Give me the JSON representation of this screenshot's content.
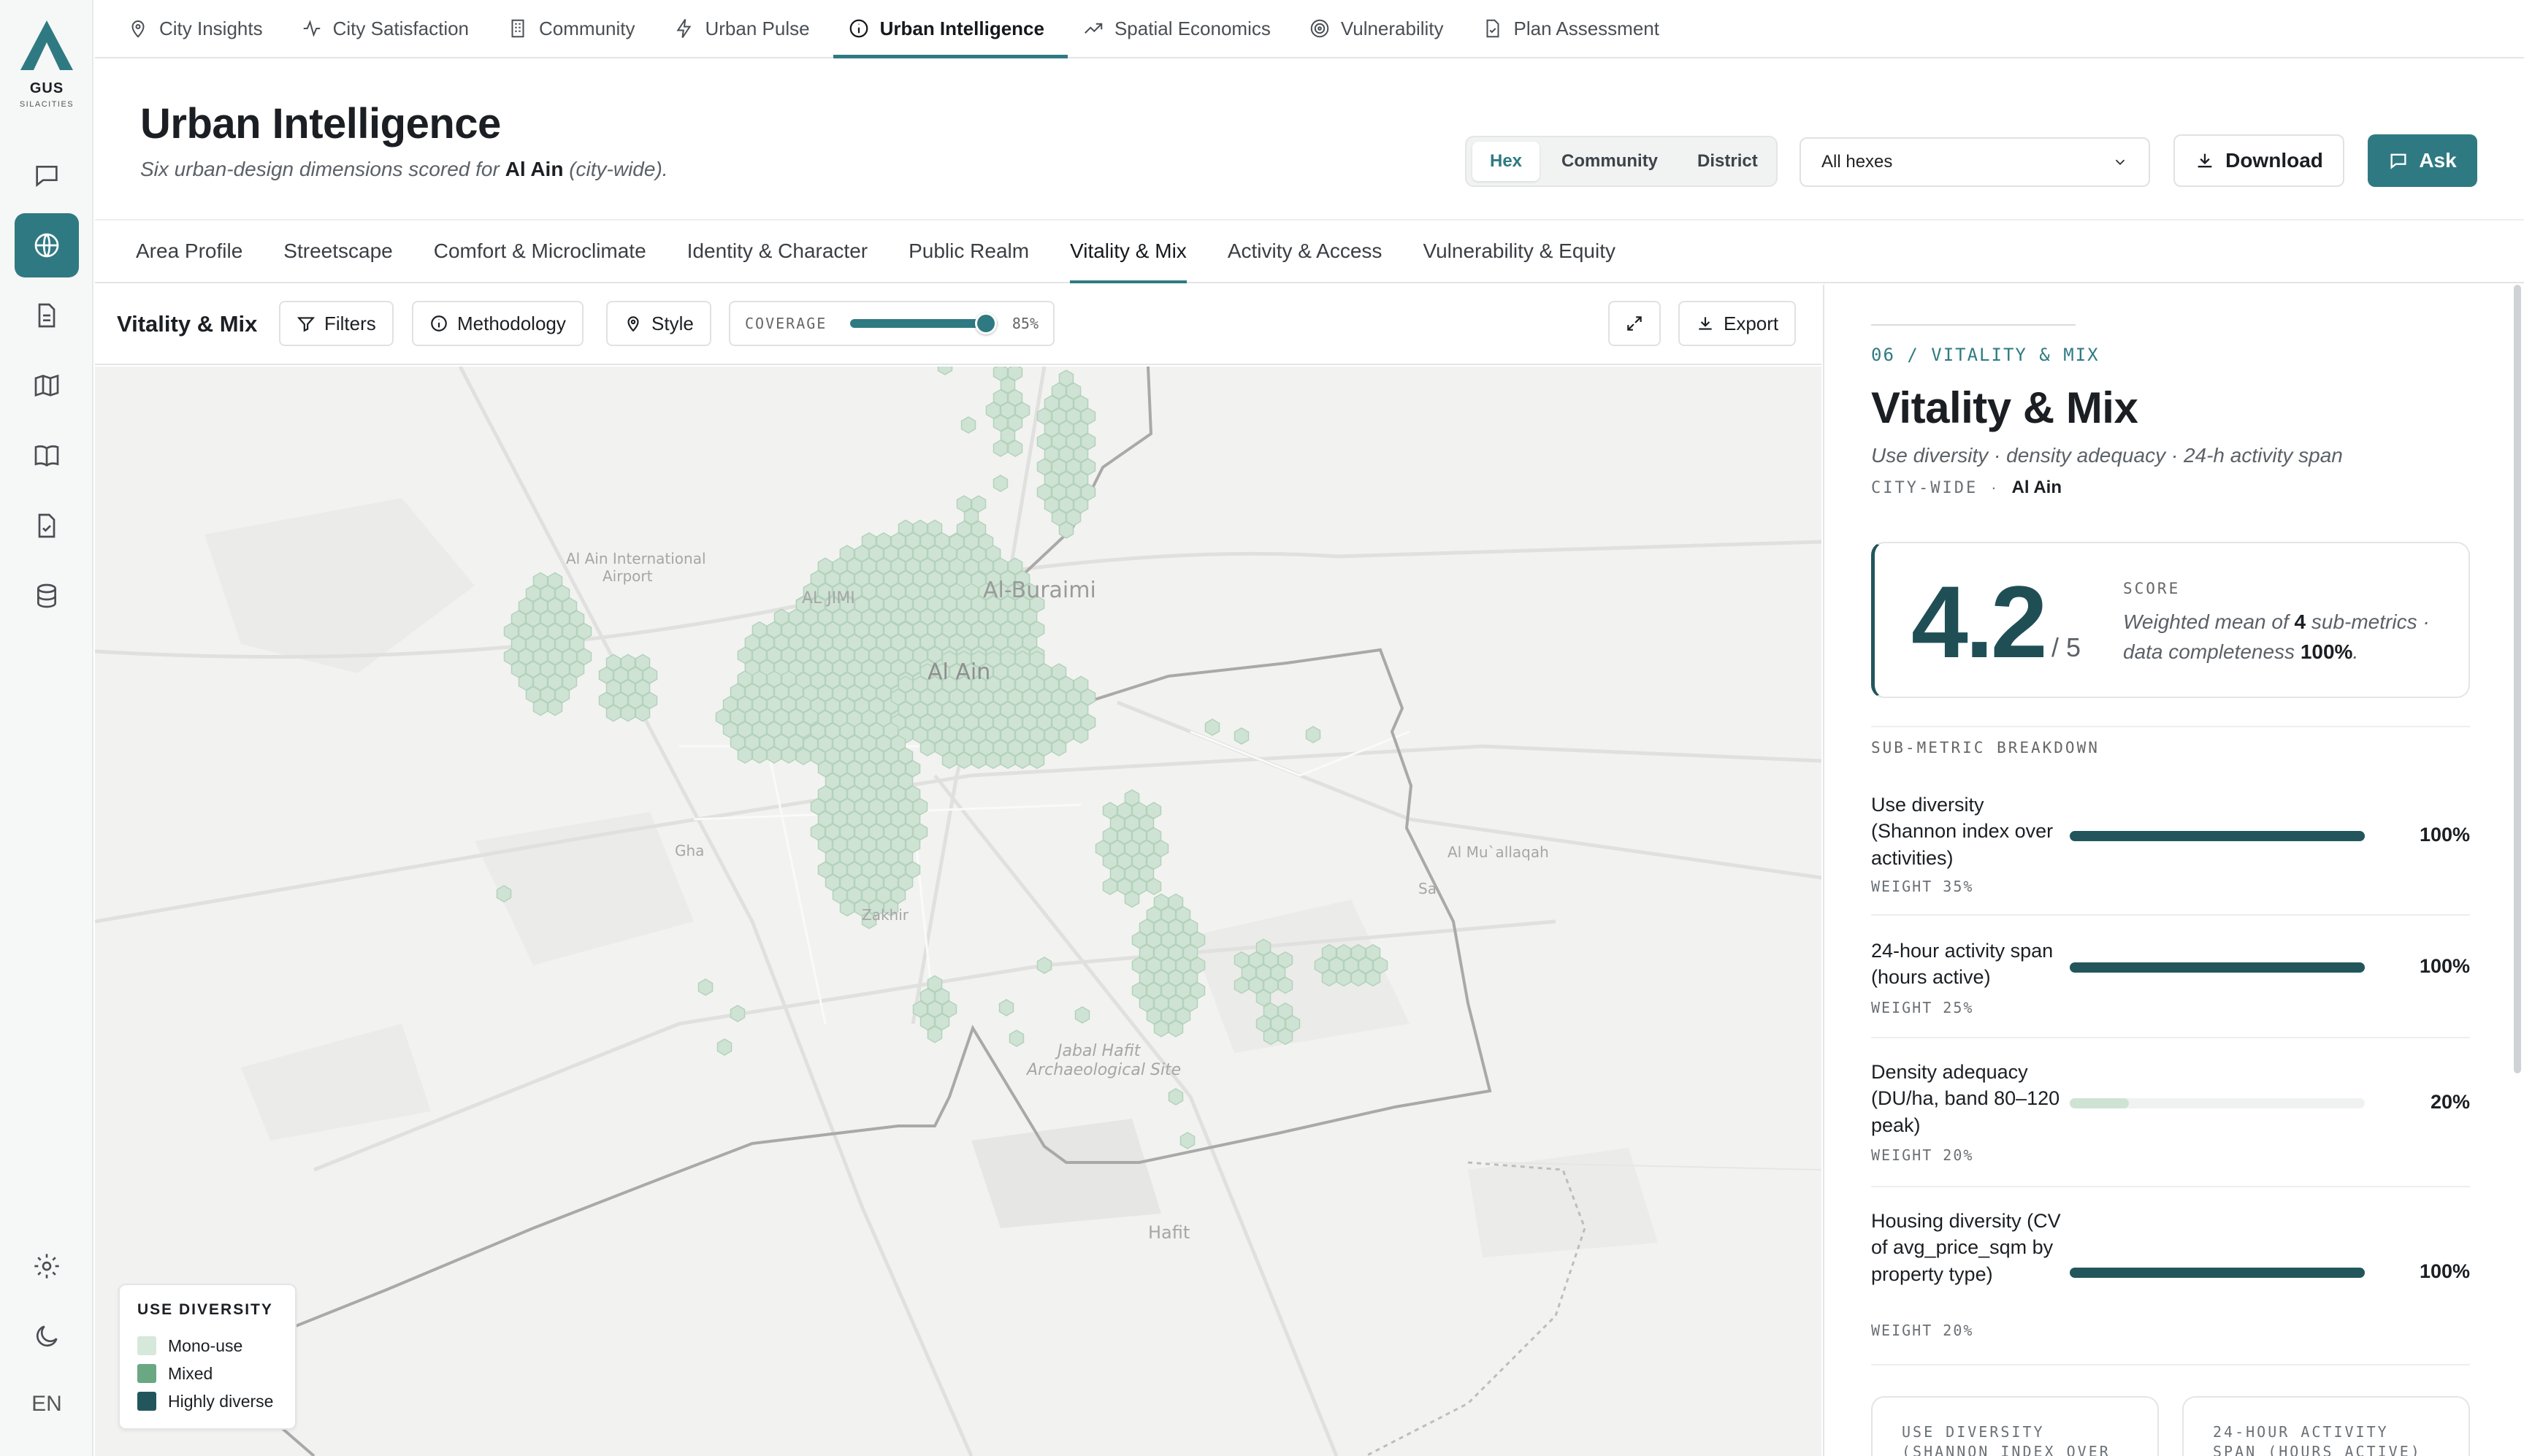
{
  "brand": {
    "name": "GUS",
    "subtitle": "SILACITIES"
  },
  "rail": {
    "items": [
      "chat-icon",
      "globe-icon",
      "document-icon",
      "map-icon",
      "book-icon",
      "checklist-icon",
      "database-icon"
    ],
    "active": "globe-icon",
    "bottom": [
      "gear-icon",
      "moon-icon"
    ],
    "language": "EN"
  },
  "topnav": {
    "items": [
      {
        "label": "City Insights",
        "icon": "pin-icon"
      },
      {
        "label": "City Satisfaction",
        "icon": "pulse-icon"
      },
      {
        "label": "Community",
        "icon": "building-icon"
      },
      {
        "label": "Urban Pulse",
        "icon": "bolt-icon"
      },
      {
        "label": "Urban Intelligence",
        "icon": "info-icon",
        "active": true
      },
      {
        "label": "Spatial Economics",
        "icon": "trend-icon"
      },
      {
        "label": "Vulnerability",
        "icon": "target-icon"
      },
      {
        "label": "Plan Assessment",
        "icon": "file-check-icon"
      }
    ]
  },
  "header": {
    "title": "Urban Intelligence",
    "subtitle_prefix": "Six urban-design dimensions scored for",
    "city": "Al Ain",
    "subtitle_suffix": "(city-wide)."
  },
  "granularity": {
    "options": [
      "Hex",
      "Community",
      "District"
    ],
    "selected": "Hex"
  },
  "filter_select": {
    "value": "All hexes"
  },
  "actions": {
    "download": "Download",
    "ask": "Ask"
  },
  "dimension_tabs": {
    "items": [
      "Area Profile",
      "Streetscape",
      "Comfort & Microclimate",
      "Identity & Character",
      "Public Realm",
      "Vitality & Mix",
      "Activity & Access",
      "Vulnerability & Equity"
    ],
    "active": "Vitality & Mix"
  },
  "map_toolbar": {
    "title": "Vitality & Mix",
    "filters": "Filters",
    "methodology": "Methodology",
    "style": "Style",
    "coverage_label": "COVERAGE",
    "coverage_value": "85%",
    "coverage_fraction": 0.85,
    "export": "Export"
  },
  "map": {
    "labels": [
      {
        "text": "Al Ain International",
        "kind": "poi"
      },
      {
        "text": "Airport",
        "kind": "poi"
      },
      {
        "text": "Al-Buraimi",
        "kind": "city"
      },
      {
        "text": "AL JIMI",
        "kind": "district"
      },
      {
        "text": "Al Ain",
        "kind": "city"
      },
      {
        "text": "Al Mu`allaqah",
        "kind": "poi"
      },
      {
        "text": "Sa",
        "kind": "poi"
      },
      {
        "text": "Gha",
        "kind": "poi"
      },
      {
        "text": "Zakhir",
        "kind": "district"
      },
      {
        "text": "Jabal Hafit",
        "kind": "poi"
      },
      {
        "text": "Archaeological Site",
        "kind": "poi"
      },
      {
        "text": "Hafit",
        "kind": "town"
      }
    ],
    "hex_fill": "#cfe3d4",
    "hex_stroke": "#b3d2bb"
  },
  "legend": {
    "title": "USE DIVERSITY",
    "items": [
      {
        "label": "Mono-use",
        "color": "#d6e8da"
      },
      {
        "label": "Mixed",
        "color": "#6aa884"
      },
      {
        "label": "Highly diverse",
        "color": "#22565c"
      }
    ]
  },
  "panel": {
    "kicker": "06 / VITALITY & MIX",
    "title": "Vitality & Mix",
    "subtitle": "Use diversity · density adequacy · 24-h activity span",
    "scope_label": "CITY-WIDE",
    "scope_sep": "·",
    "scope_value": "Al Ain",
    "score": {
      "value": "4.2",
      "max": "/ 5",
      "label": "SCORE",
      "desc_a": "Weighted mean of",
      "desc_count": "4",
      "desc_b": "sub-metrics",
      "desc_c": "· data completeness",
      "desc_pct": "100%",
      "desc_end": "."
    },
    "breakdown_title": "SUB-METRIC BREAKDOWN",
    "metrics": [
      {
        "name": "Use diversity (Shannon index over activities)",
        "weight": "WEIGHT 35%",
        "value": "100%",
        "fraction": 1.0
      },
      {
        "name": "24-hour activity span (hours active)",
        "weight": "WEIGHT 25%",
        "value": "100%",
        "fraction": 1.0
      },
      {
        "name": "Density adequacy (DU/ha, band 80–120 peak)",
        "weight": "WEIGHT 20%",
        "value": "20%",
        "fraction": 0.2
      },
      {
        "name": "Housing diversity (CV of avg_price_sqm by property type)",
        "weight": "WEIGHT 20%",
        "value": "100%",
        "fraction": 1.0
      }
    ],
    "mini_cards": [
      {
        "line1": "USE DIVERSITY",
        "line2": "(SHANNON INDEX OVER"
      },
      {
        "line1": "24-HOUR ACTIVITY",
        "line2": "SPAN (HOURS ACTIVE)"
      }
    ]
  },
  "colors": {
    "accent": "#2f7a82",
    "dark": "#22565c",
    "low_bar": "#cfe3d4"
  }
}
